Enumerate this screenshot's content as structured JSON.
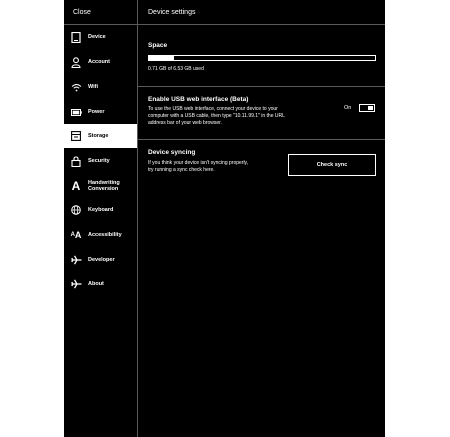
{
  "sidebar": {
    "close_label": "Close",
    "items": [
      {
        "label": "Device",
        "icon": "tablet-icon"
      },
      {
        "label": "Account",
        "icon": "user-icon"
      },
      {
        "label": "Wifi",
        "icon": "wifi-icon"
      },
      {
        "label": "Power",
        "icon": "battery-icon"
      },
      {
        "label": "Storage",
        "icon": "storage-icon",
        "active": true
      },
      {
        "label": "Security",
        "icon": "lock-icon"
      },
      {
        "label": "Handwriting",
        "label_line2": "Conversion",
        "icon": "letter-a-icon"
      },
      {
        "label": "Keyboard",
        "icon": "globe-icon"
      },
      {
        "label": "Accessibility",
        "icon": "text-size-icon"
      },
      {
        "label": "Developer",
        "icon": "airplane-icon"
      },
      {
        "label": "About",
        "icon": "airplane-icon"
      }
    ]
  },
  "header": {
    "title": "Device settings"
  },
  "space": {
    "title": "Space",
    "usage_text": "0.71 GB of 6.53 GB used",
    "used_fraction": 0.109
  },
  "usb": {
    "title": "Enable USB web interface (Beta)",
    "description_line1": "To use the USB web interface, connect your device to your",
    "description_line2": "computer with a USB cable, then type \"10.11.99.1\" in the URL",
    "description_line3": "address bar of your web browser.",
    "toggle_label": "On",
    "enabled": true
  },
  "sync": {
    "title": "Device syncing",
    "description_line1": "If you think your device isn't syncing properly,",
    "description_line2": "try running a sync check here.",
    "button_label": "Check sync"
  }
}
